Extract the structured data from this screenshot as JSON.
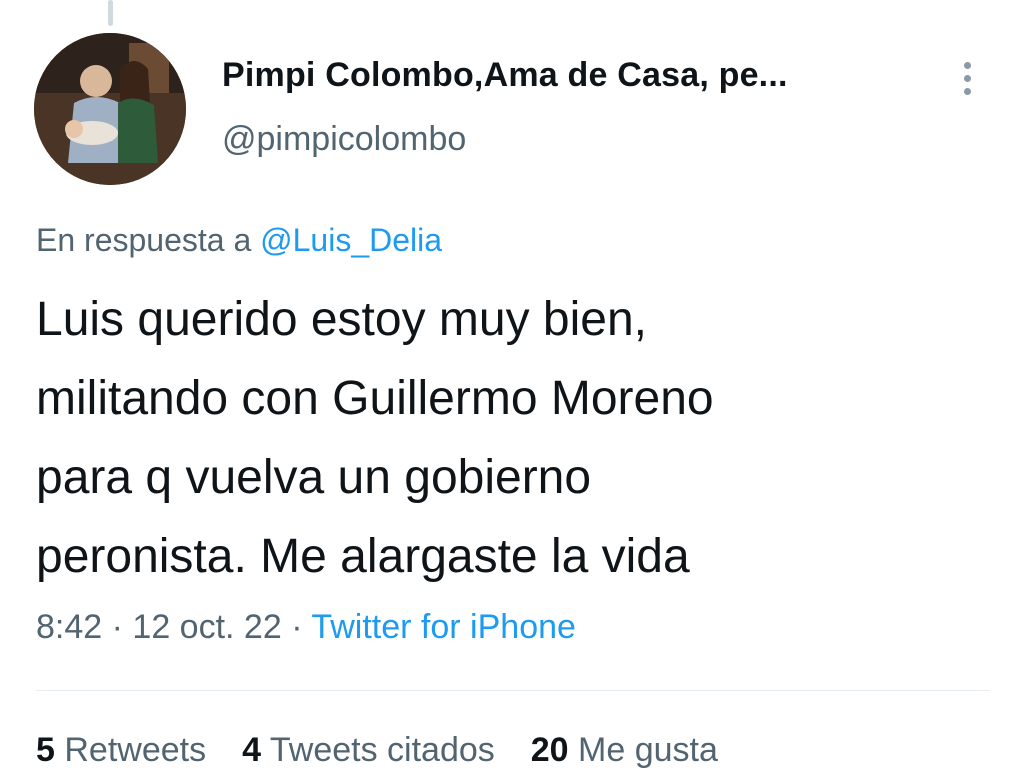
{
  "author": {
    "display_name": "Pimpi Colombo,Ama de Casa, pe...",
    "handle": "@pimpicolombo",
    "avatar_icon": "profile-photo"
  },
  "reply": {
    "prefix": "En respuesta a ",
    "mention": "@Luis_Delia"
  },
  "tweet": {
    "lines": [
      "Luis querido estoy muy bien,",
      "militando con Guillermo Moreno",
      "para q vuelva un gobierno",
      "peronista. Me alargaste la vida"
    ]
  },
  "meta": {
    "time": "8:42",
    "separator": " · ",
    "date": "12 oct. 22",
    "source": "Twitter for iPhone"
  },
  "stats": {
    "retweets_count": "5",
    "retweets_label": "Retweets",
    "quotes_count": "4",
    "quotes_label": "Tweets citados",
    "likes_count": "20",
    "likes_label": "Me gusta"
  },
  "colors": {
    "link": "#1d9bf0",
    "secondary_text": "#536471",
    "primary_text": "#0f1419"
  }
}
